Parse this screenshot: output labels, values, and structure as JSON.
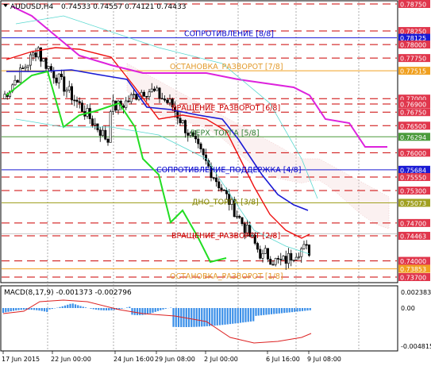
{
  "header": {
    "symbol": "AUDUSD,H4",
    "ohlc": "0.74533 0.74557 0.74121 0.74433"
  },
  "levels": [
    {
      "label": "СОПРОТИВЛЕНИЕ [8/8]",
      "color": "#0000cc"
    },
    {
      "label": "ОСТАНОВКА_РАЗВОРОТ [7/8]",
      "color": "#e39b2c"
    },
    {
      "label": "ВРАЩЕНИЕ_РАЗВОРОТ [6/8]",
      "color": "#cc0000"
    },
    {
      "label": "ВЕРХ_ТОРГА [5/8]",
      "color": "#2e7d32"
    },
    {
      "label": "СОПРОТИВЛЕНИЕ_ПОДДЕРЖКА [4/8]",
      "color": "#0000cc"
    },
    {
      "label": "ДНО_ТОРГА [3/8]",
      "color": "#808000"
    },
    {
      "label": "ВРАЩЕНИЕ_РАЗВОРОТ [2/8]",
      "color": "#cc0000"
    },
    {
      "label": "ОСТАНОВКА_РАЗВОРОТ [1/8]",
      "color": "#e39b2c"
    }
  ],
  "price_axis": [
    {
      "value": "0.78750",
      "bg": "#e0364c"
    },
    {
      "value": "0.78250",
      "bg": "#e0364c"
    },
    {
      "value": "0.78125",
      "bg": "#1a1ad4"
    },
    {
      "value": "0.78000",
      "bg": "#e0364c"
    },
    {
      "value": "0.77750",
      "bg": "#e0364c"
    },
    {
      "value": "0.77515",
      "bg": "#f0a020"
    },
    {
      "value": "0.77000",
      "bg": "#e0364c"
    },
    {
      "value": "0.76900",
      "bg": "#e0364c"
    },
    {
      "value": "0.76750",
      "bg": "#e0364c"
    },
    {
      "value": "0.76500",
      "bg": "#e0364c"
    },
    {
      "value": "0.76294",
      "bg": "#4a9a3a"
    },
    {
      "value": "0.76000",
      "bg": "#e0364c"
    },
    {
      "value": "0.75684",
      "bg": "#1a1ad4"
    },
    {
      "value": "0.75550",
      "bg": "#e0364c"
    },
    {
      "value": "0.75300",
      "bg": "#e0364c"
    },
    {
      "value": "0.75073",
      "bg": "#a0a020"
    },
    {
      "value": "0.74700",
      "bg": "#e0364c"
    },
    {
      "value": "0.74463",
      "bg": "#e0364c"
    },
    {
      "value": "0.74000",
      "bg": "#e0364c"
    },
    {
      "value": "0.73853",
      "bg": "#f0a020"
    },
    {
      "value": "0.73700",
      "bg": "#e0364c"
    }
  ],
  "macd": {
    "label": "MACD(8,17,9) -0.001373 -0.002796",
    "scale_top": "0.002383",
    "scale_zero": "0.00",
    "scale_bottom": "-0.004815"
  },
  "time_axis": [
    "17 Jun 2015",
    "22 Jun 00:00",
    "24 Jun 16:00",
    "29 Jun 08:00",
    "2 Jul 00:00",
    "6 Jul 16:00",
    "9 Jul 08:00"
  ],
  "colors": {
    "candle": "#000000",
    "level_red": "#cc0000",
    "ma_blue": "#1a1ad4",
    "ma_red": "#ee1111",
    "ma_green": "#22dd22",
    "ma_magenta": "#dd22dd",
    "macd_bar": "#3b8fe8",
    "signal": "#dd2222"
  }
}
